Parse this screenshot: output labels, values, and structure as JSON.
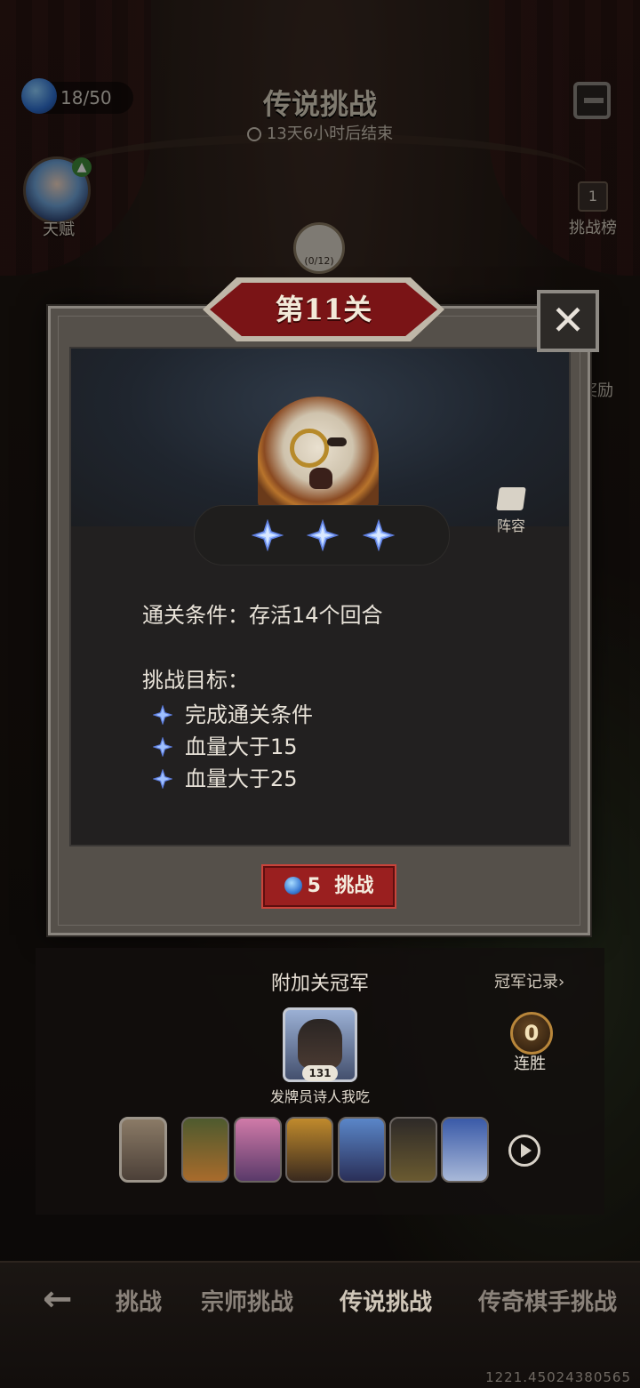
{
  "header": {
    "stamina": "18/50",
    "title": "传说挑战",
    "countdown": "13天6小时后结束",
    "avatar_label": "天赋"
  },
  "side_buttons": {
    "leaderboard_badge": "1",
    "leaderboard_label": "挑战榜",
    "reward_label": "奖励"
  },
  "medal_counter": "(0/12)",
  "modal": {
    "level_title": "第11关",
    "close_label": "✕",
    "lineup_label": "阵容",
    "stars_earned": 3,
    "clear_condition": "通关条件：存活14个回合",
    "goals_title": "挑战目标：",
    "goals": [
      "完成通关条件",
      "血量大于15",
      "血量大于25"
    ],
    "challenge_cost": "5",
    "challenge_label": "挑战"
  },
  "champion": {
    "title": "附加关冠军",
    "record_link": "冠军记录›",
    "level": "131",
    "name": "发牌员诗人我吃",
    "win_streak": "0",
    "win_streak_label": "连胜",
    "team_count": 7
  },
  "tabs": [
    "挑战",
    "宗师挑战",
    "传说挑战",
    "传奇棋手挑战"
  ],
  "active_tab": "传说挑战",
  "version": "1221.45024380565",
  "colors": {
    "accent_red": "#9a1f1f",
    "star_blue": "#8fb4ff",
    "panel": "#222020"
  }
}
